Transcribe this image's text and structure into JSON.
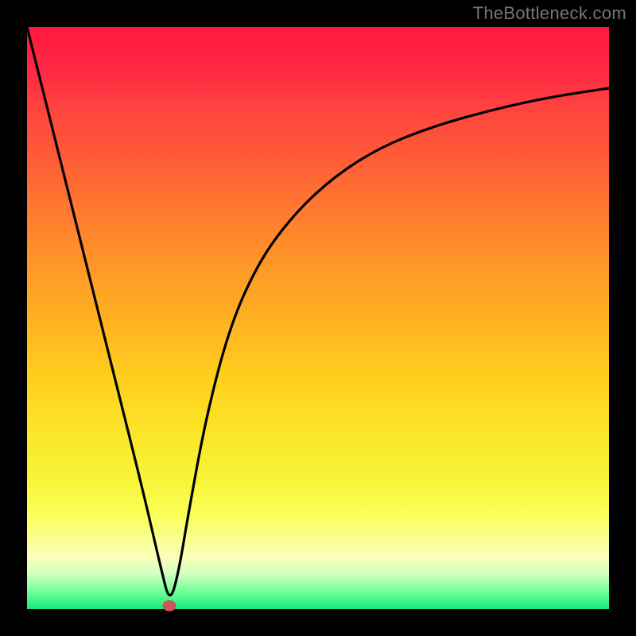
{
  "watermark": "TheBottleneck.com",
  "chart_data": {
    "type": "line",
    "title": "",
    "xlabel": "",
    "ylabel": "",
    "xlim": [
      0,
      100
    ],
    "ylim": [
      0,
      100
    ],
    "series": [
      {
        "name": "bottleneck-curve",
        "x": [
          0,
          5,
          10,
          15,
          20,
          23,
          24.5,
          26,
          28,
          31,
          35,
          40,
          46,
          53,
          61,
          70,
          80,
          90,
          100
        ],
        "values": [
          100,
          80,
          60,
          40,
          20,
          7,
          1,
          6,
          18,
          34,
          49,
          60,
          68,
          74.5,
          79.5,
          83,
          85.8,
          88,
          89.5
        ]
      }
    ],
    "marker": {
      "x": 24.5,
      "y": 0.6,
      "color": "#cd5757"
    },
    "gradient_stops": [
      {
        "pos": 0,
        "color": "#ff1940"
      },
      {
        "pos": 8,
        "color": "#ff2a43"
      },
      {
        "pos": 14,
        "color": "#ff433f"
      },
      {
        "pos": 22,
        "color": "#ff5a38"
      },
      {
        "pos": 30,
        "color": "#ff7530"
      },
      {
        "pos": 38,
        "color": "#ff8e2a"
      },
      {
        "pos": 46,
        "color": "#ffa524"
      },
      {
        "pos": 54,
        "color": "#ffbc1f"
      },
      {
        "pos": 62,
        "color": "#ffd31e"
      },
      {
        "pos": 70,
        "color": "#fbe628"
      },
      {
        "pos": 78,
        "color": "#f8f43a"
      },
      {
        "pos": 84,
        "color": "#faff5a"
      },
      {
        "pos": 91,
        "color": "#fbffb9"
      },
      {
        "pos": 94,
        "color": "#d2ffc0"
      },
      {
        "pos": 97,
        "color": "#6fff9a"
      },
      {
        "pos": 100,
        "color": "#19ea7c"
      }
    ]
  }
}
